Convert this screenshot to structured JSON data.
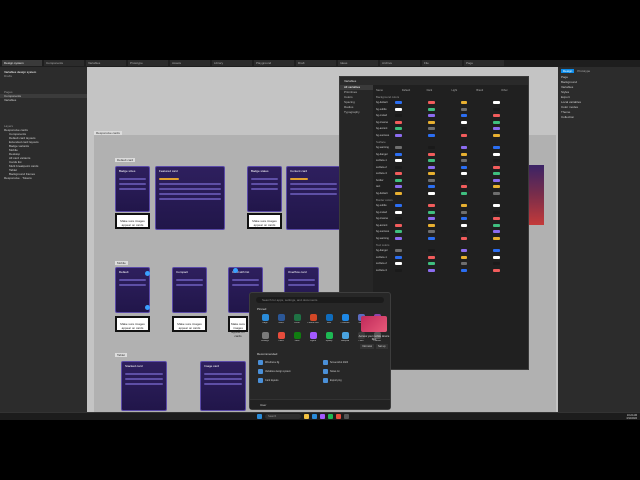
{
  "tabs": [
    {
      "label": "Design system"
    },
    {
      "label": "Components"
    },
    {
      "label": "Variables"
    },
    {
      "label": "Prototype"
    },
    {
      "label": "Assets"
    },
    {
      "label": "Library"
    },
    {
      "label": "Playground"
    },
    {
      "label": "Draft"
    },
    {
      "label": "Ideas"
    },
    {
      "label": "Archive"
    },
    {
      "label": "File"
    },
    {
      "label": "Page"
    }
  ],
  "left_panel": {
    "file_name": "Variables design system",
    "drafts": "Drafts",
    "pages_label": "Pages",
    "pages": [
      "Components",
      "Variables"
    ],
    "layers_label": "Layers",
    "layers": [
      "Responsive cards",
      "Components",
      "Default card layouts",
      "Extended card layouts",
      "Badge variants",
      "Mobile",
      "Desktop",
      "All card variants",
      "Cards list",
      "Multi breakpoint cards",
      "Tablet",
      "Background frames",
      "Responsive · Tokens"
    ]
  },
  "right_panel": {
    "tabs": [
      "Design",
      "Prototype"
    ],
    "rows": [
      "Page",
      "Background",
      "Variables",
      "Styles",
      "Export",
      "Local variables",
      "Color modes",
      "Theme",
      "Collection"
    ]
  },
  "canvas": {
    "frame_label": "Responsive cards",
    "group_labels": [
      "Default card",
      "Mobile",
      "Tablet"
    ],
    "card_titles": [
      "Badge sizes",
      "Featured card",
      "Badge states",
      "Content card",
      "Default",
      "Compact",
      "Card with list",
      "Overflow card",
      "Stacked card",
      "Image card"
    ],
    "white_box_text": "Make sure images appear on cards"
  },
  "variables_dialog": {
    "title": "Variables",
    "sidebar": [
      "All variables",
      "Primitives",
      "Colors",
      "Spacing",
      "Radius",
      "Typography"
    ],
    "columns": [
      "Name",
      "Default",
      "Dark",
      "Light",
      "Brand",
      "Other"
    ],
    "sections": [
      "Background colors",
      "Surface",
      "Border colors",
      "Text colors"
    ],
    "row_names": [
      "bg-default",
      "bg-subtle",
      "bg-muted",
      "bg-inverse",
      "bg-accent",
      "bg-success",
      "bg-warning",
      "bg-danger",
      "surface-1",
      "surface-2",
      "surface-3",
      "border",
      "text"
    ],
    "swatches": [
      "#2b6ef2",
      "#ffffff",
      "#1a1a1a",
      "#f25c5c",
      "#3fbf7f",
      "#8c6cf0",
      "#e8b030",
      "#6e6e6e"
    ]
  },
  "start_menu": {
    "search_placeholder": "Search for apps, settings, and documents",
    "pinned_label": "Pinned",
    "all_apps": "All apps",
    "apps": [
      {
        "name": "Edge",
        "color": "#2a8bd8"
      },
      {
        "name": "Word",
        "color": "#2b5797"
      },
      {
        "name": "Excel",
        "color": "#1f7244"
      },
      {
        "name": "PowerPoint",
        "color": "#d24726"
      },
      {
        "name": "Mail",
        "color": "#0f6cbd"
      },
      {
        "name": "Calendar",
        "color": "#1e88e5"
      },
      {
        "name": "Store",
        "color": "#5c6bc0"
      },
      {
        "name": "Photos",
        "color": "#8e44ad"
      },
      {
        "name": "Settings",
        "color": "#7a7a7a"
      },
      {
        "name": "Office",
        "color": "#e74c3c"
      },
      {
        "name": "Xbox",
        "color": "#107c10"
      },
      {
        "name": "Figma",
        "color": "#a259ff"
      },
      {
        "name": "Spotify",
        "color": "#1db954"
      },
      {
        "name": "Notepad",
        "color": "#4aa3df"
      },
      {
        "name": "Clock",
        "color": "#3a3a3a"
      },
      {
        "name": "Camera",
        "color": "#555555"
      }
    ],
    "recommended_label": "Recommended",
    "more": "More",
    "recommended": [
      {
        "name": "Wireframe.fig",
        "sub": "Recently added"
      },
      {
        "name": "Screenshot 2024",
        "sub": "Yesterday"
      },
      {
        "name": "Variables design system",
        "sub": "2h ago"
      },
      {
        "name": "Notes.txt",
        "sub": "Last week"
      },
      {
        "name": "Card layouts",
        "sub": "Monday"
      },
      {
        "name": "Export.png",
        "sub": "Sunday"
      }
    ],
    "user": "User",
    "ad_title": "Access your mobile device files",
    "ad_btn1": "Not now",
    "ad_btn2": "Set up"
  },
  "taskbar": {
    "search_placeholder": "Search",
    "time": "10:24 AM",
    "date": "3/12/2024"
  }
}
